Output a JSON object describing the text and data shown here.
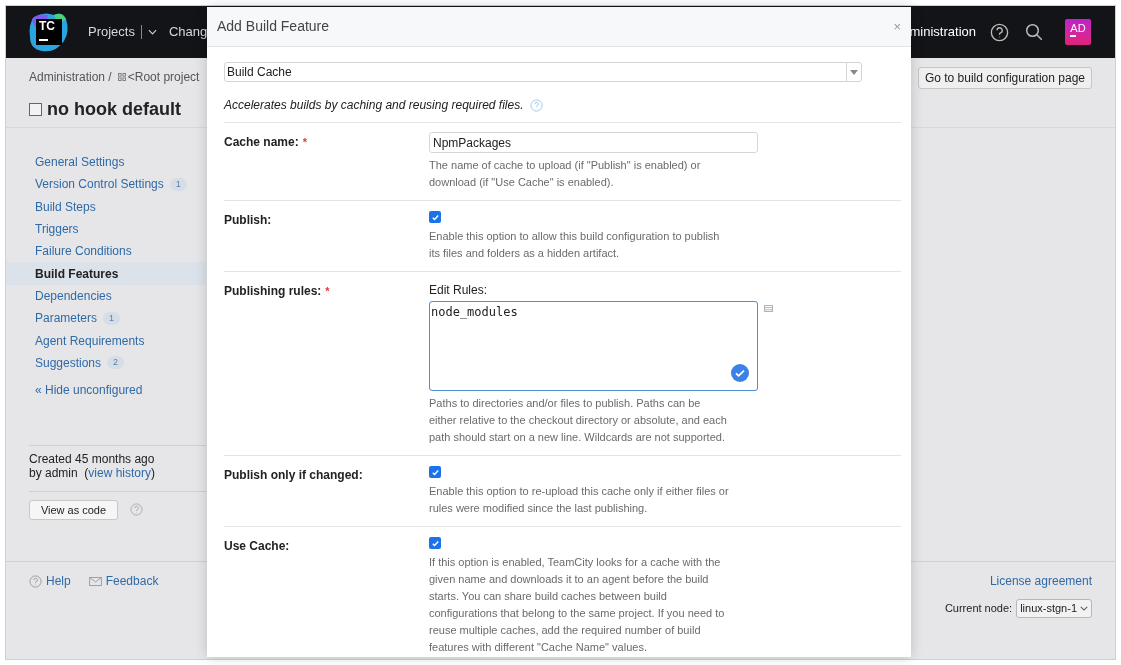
{
  "top_bar": {
    "logo": "TC",
    "nav": [
      {
        "label": "Projects"
      },
      {
        "label": "Chang"
      }
    ],
    "admin_link": "ministration",
    "avatar": "AD"
  },
  "header": {
    "breadcrumb": [
      "Administration /",
      "<Root project"
    ],
    "title": "no hook default",
    "goto_button": "Go to build configuration page"
  },
  "sidebar": {
    "items": [
      {
        "label": "General Settings",
        "selected": false
      },
      {
        "label": "Version Control Settings",
        "count": "1",
        "selected": false
      },
      {
        "label": "Build Steps",
        "selected": false
      },
      {
        "label": "Triggers",
        "selected": false
      },
      {
        "label": "Failure Conditions",
        "selected": false
      },
      {
        "label": "Build Features",
        "selected": true
      },
      {
        "label": "Dependencies",
        "selected": false
      },
      {
        "label": "Parameters",
        "count": "1",
        "selected": false
      },
      {
        "label": "Agent Requirements",
        "selected": false
      },
      {
        "label": "Suggestions",
        "count": "2",
        "selected": false
      }
    ],
    "hide_link": "« Hide unconfigured",
    "created": "Created 45 months ago",
    "by_prefix": "by admin  (",
    "history_link": "view history",
    "by_suffix": ")",
    "view_code_button": "View as code"
  },
  "footer": {
    "help": "Help",
    "feedback": "Feedback",
    "license": "License agreement",
    "node_label": "Current node:",
    "node_value": "linux-stgn-1"
  },
  "dialog": {
    "title": "Add Build Feature",
    "close": "×",
    "feature_select": "Build Cache",
    "description": "Accelerates builds by caching and reusing required files.",
    "fields": [
      {
        "kind": "text",
        "label": "Cache name:",
        "required_mark": "*",
        "value": "NpmPackages",
        "help": "The name of cache to upload (if \"Publish\" is enabled) or download (if \"Use Cache\" is enabled)."
      },
      {
        "kind": "checkbox",
        "label": "Publish:",
        "checked": true,
        "help": "Enable this option to allow this build configuration to publish its files and folders as a hidden artifact."
      },
      {
        "kind": "textarea",
        "label": "Publishing rules:",
        "required_mark": "*",
        "caption": "Edit Rules:",
        "value": "node_modules",
        "help": "Paths to directories and/or files to publish. Paths can be either relative to the checkout directory or absolute, and each path should start on a new line. Wildcards are not supported."
      },
      {
        "kind": "checkbox",
        "label": "Publish only if changed:",
        "checked": true,
        "help": "Enable this option to re-upload this cache only if either files or rules were modified since the last publishing."
      },
      {
        "kind": "checkbox",
        "label": "Use Cache:",
        "checked": true,
        "help": "If this option is enabled, TeamCity looks for a cache with the given name and downloads it to an agent before the build starts. You can share build caches between build configurations that belong to the same project. If you need to reuse multiple caches, add the required number of build features with different \"Cache Name\" values."
      }
    ]
  }
}
